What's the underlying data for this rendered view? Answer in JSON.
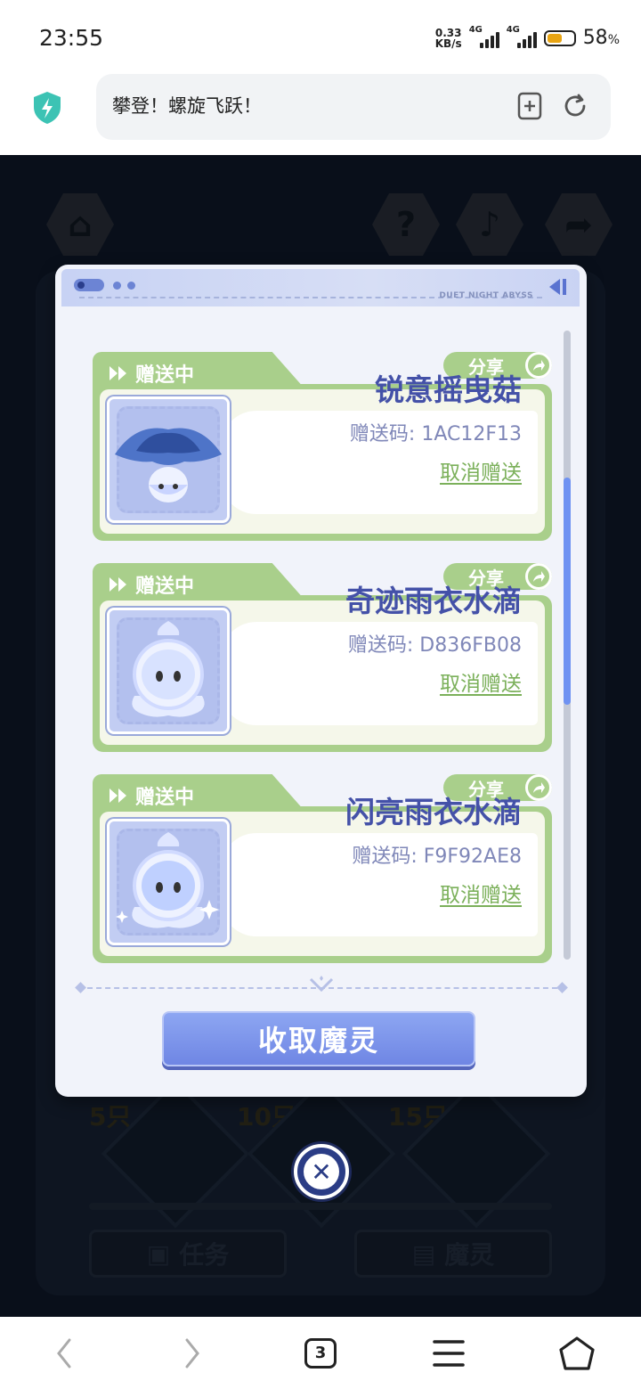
{
  "status_bar": {
    "time": "23:55",
    "net_speed_value": "0.33",
    "net_speed_unit": "KB/s",
    "sim1_label": "4G",
    "sim2_label": "4G",
    "battery_percent": "58",
    "battery_unit": "%",
    "battery_level": 0.58
  },
  "browser": {
    "page_title": "攀登！螺旋飞跃！",
    "tab_count": "3"
  },
  "modal": {
    "header_brand": "DUET NIGHT ABYSS",
    "collect_button": "收取魔灵",
    "items": [
      {
        "status": "赠送中",
        "share": "分享",
        "name": "锐意摇曳菇",
        "code": "赠送码: 1AC12F13",
        "cancel": "取消赠送"
      },
      {
        "status": "赠送中",
        "share": "分享",
        "name": "奇迹雨衣水滴",
        "code": "赠送码: D836FB08",
        "cancel": "取消赠送"
      },
      {
        "status": "赠送中",
        "share": "分享",
        "name": "闪亮雨衣水滴",
        "code": "赠送码: F9F92AE8",
        "cancel": "取消赠送"
      }
    ]
  },
  "background": {
    "milestones": [
      "5只",
      "10只",
      "15只"
    ],
    "tab_task": "任务",
    "tab_spirit": "魔灵"
  },
  "colors": {
    "accent_green": "#a9cf8b",
    "accent_blue": "#6f86e4",
    "name_color": "#4451a8"
  }
}
